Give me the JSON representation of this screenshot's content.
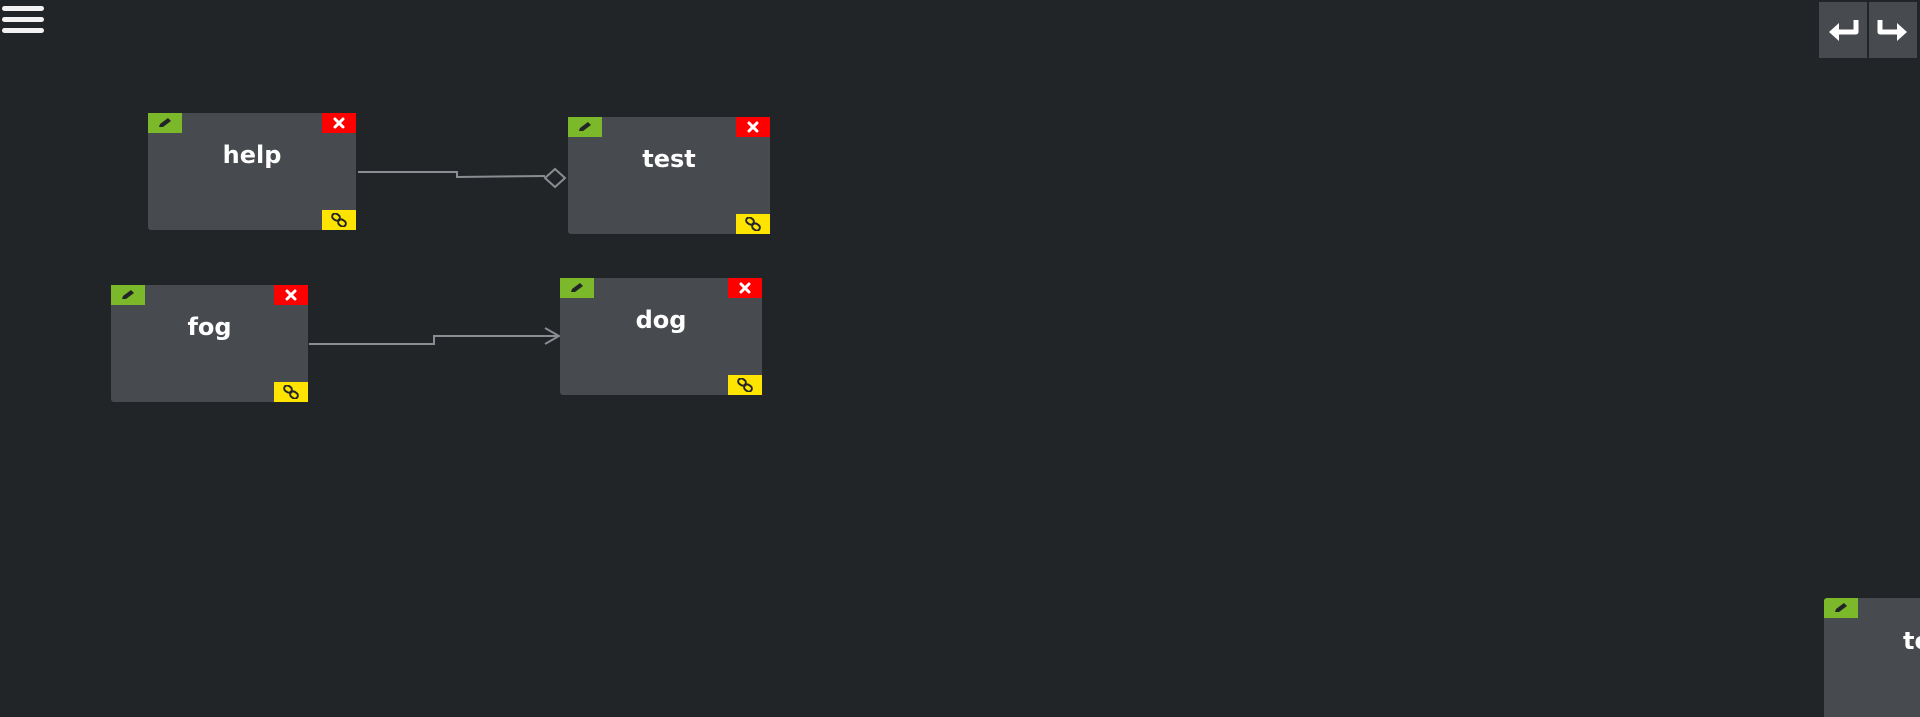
{
  "toolbar": {
    "menu_icon": "hamburger-menu-icon",
    "undo_icon": "undo-arrow-icon",
    "redo_icon": "redo-arrow-icon"
  },
  "colors": {
    "background": "#222528",
    "node": "#474a4f",
    "edit": "#7bb82a",
    "delete": "#ff0000",
    "link": "#ffe400",
    "edge": "#8a8d91"
  },
  "nodes": [
    {
      "id": "help",
      "label": "help"
    },
    {
      "id": "test",
      "label": "test"
    },
    {
      "id": "fog",
      "label": "fog"
    },
    {
      "id": "dog",
      "label": "dog"
    },
    {
      "id": "partial",
      "label": "te"
    }
  ],
  "edges": [
    {
      "from": "help",
      "to": "test",
      "marker": "diamond"
    },
    {
      "from": "fog",
      "to": "dog",
      "marker": "arrow"
    }
  ]
}
